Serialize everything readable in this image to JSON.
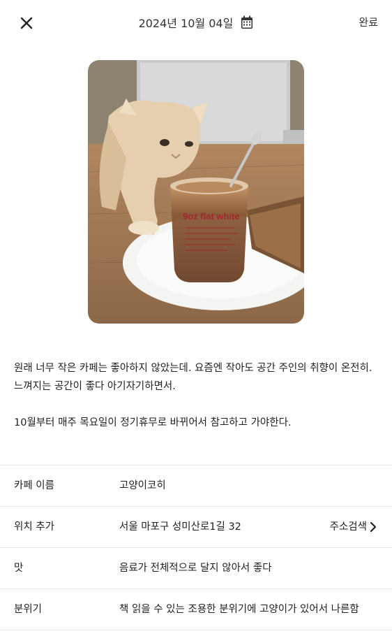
{
  "header": {
    "date": "2024년 10월 04일",
    "done_label": "완료",
    "close_icon": "close-icon",
    "calendar_icon": "calendar-icon"
  },
  "photo": {
    "cup_text": "9oz flat white"
  },
  "memo": {
    "line1": "원래 너무 작은 카페는 좋아하지 않았는데. 요즘엔 작아도 공간 주인의 취향이 온전히. 느껴지는 공간이 좋다 아기자기하면서.",
    "line2": "10월부터 매주 목요일이 정기휴무로 바뀌어서 참고하고 가야한다."
  },
  "info": {
    "rows": [
      {
        "label": "카페 이름",
        "value": "고양이코히"
      },
      {
        "label": "위치 추가",
        "value": "서울 마포구 성미산로1길 32",
        "action": "주소검색"
      },
      {
        "label": "맛",
        "value": "음료가 전체적으로 달지 않아서 좋다"
      },
      {
        "label": "분위기",
        "value": "책 읽을 수 있는 조용한 분위기에 고양이가 있어서 나른함"
      }
    ]
  },
  "colors": {
    "text": "#222222",
    "divider": "#e6e6e6",
    "background": "#ffffff"
  }
}
